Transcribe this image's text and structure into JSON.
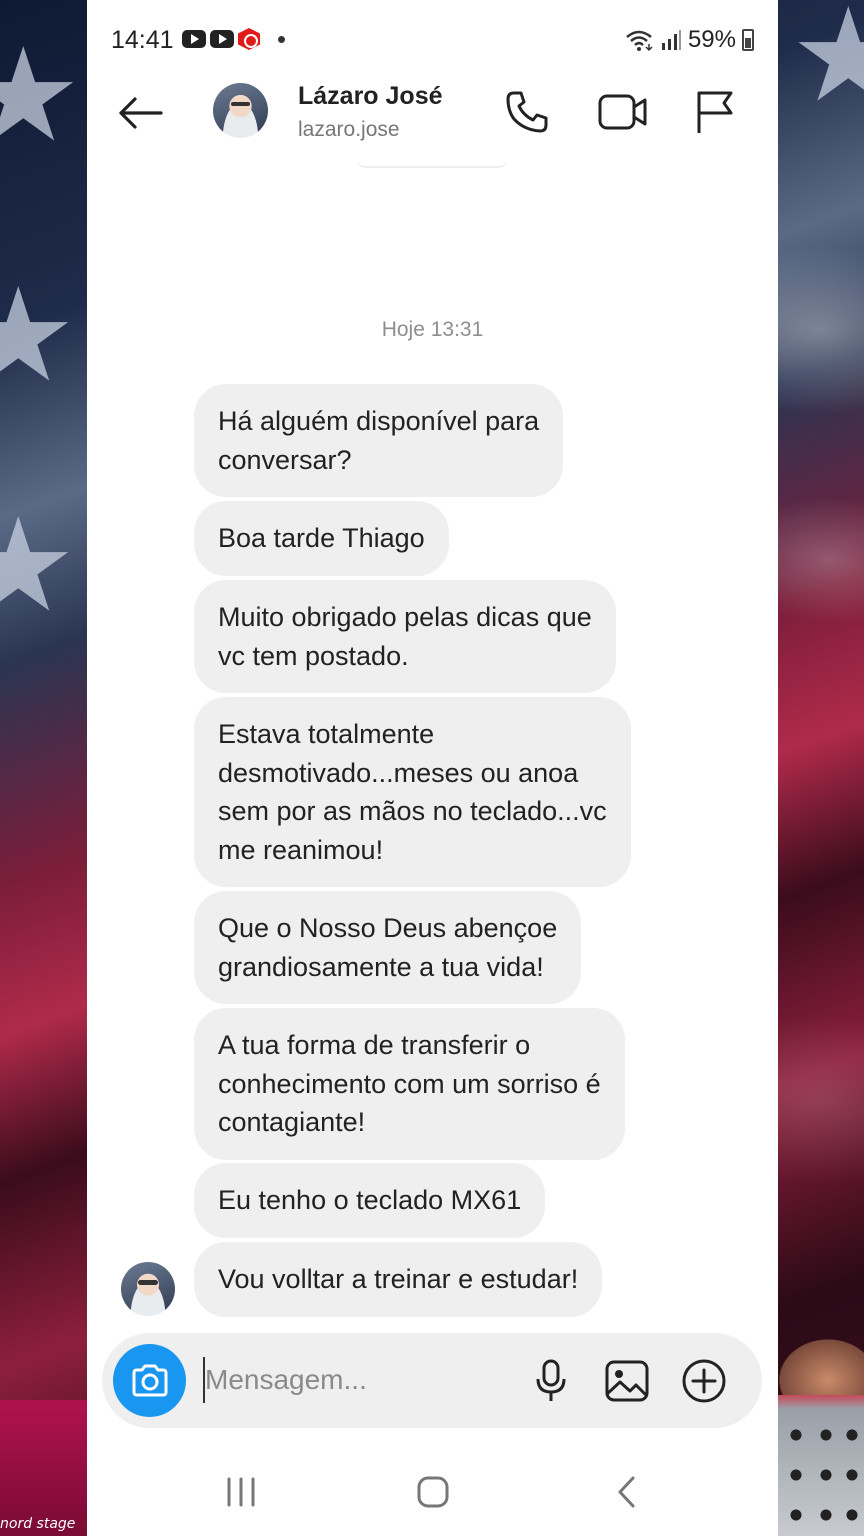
{
  "status_bar": {
    "time": "14:41",
    "battery": "59%",
    "notification_icons": [
      "youtube-icon",
      "youtube-icon",
      "youtube-music-icon",
      "dot-icon"
    ],
    "right_icons": [
      "wifi-icon",
      "signal-icon",
      "battery-icon"
    ]
  },
  "header": {
    "name": "Lázaro José",
    "username": "lazaro.jose",
    "actions": [
      "phone-call-icon",
      "video-call-icon",
      "flag-icon"
    ]
  },
  "chat": {
    "timestamp": "Hoje 13:31",
    "messages": [
      "Há alguém disponível para\nconversar?",
      "Boa tarde Thiago",
      "Muito obrigado pelas dicas que\nvc tem postado.",
      "Estava totalmente\ndesmotivado...meses ou anoa\nsem por as mãos no teclado...vc\nme reanimou!",
      "Que o Nosso Deus abençoe\ngrandiosamente a tua vida!",
      "A tua forma de transferir o\nconhecimento com um sorriso é\ncontagiante!",
      "Eu tenho o teclado MX61",
      "Vou volltar a treinar e estudar!"
    ]
  },
  "composer": {
    "placeholder": "Mensagem...",
    "icons": [
      "camera-icon",
      "microphone-icon",
      "gallery-icon",
      "plus-circle-icon"
    ]
  },
  "nav_bar": {
    "icons": [
      "recent-apps-icon",
      "home-icon",
      "back-icon"
    ]
  },
  "background": {
    "watermark_text": "nord stage"
  },
  "colors": {
    "accent": "#1896f0",
    "bubble": "#efefef",
    "text": "#222222",
    "muted": "#8e8e8e"
  }
}
